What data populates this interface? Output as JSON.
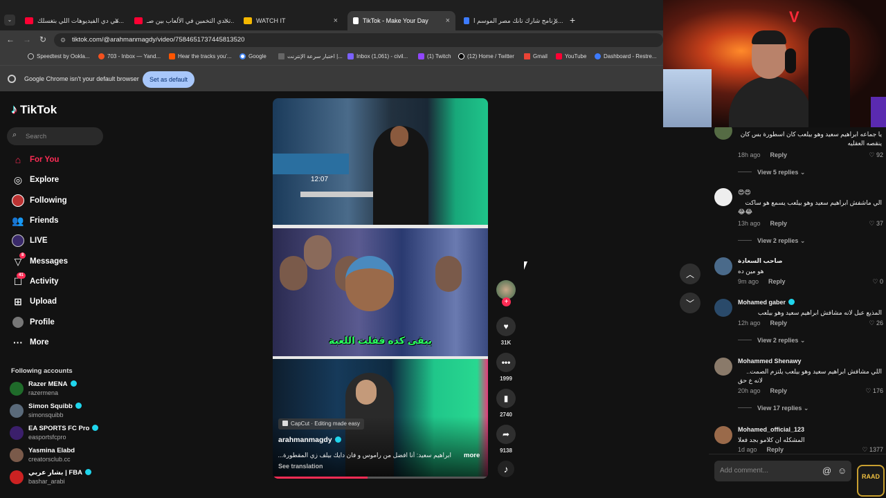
{
  "tabs": [
    {
      "title": "هي دي الفيديوهات اللي بتغسلك...",
      "icon_color": "#ff0033"
    },
    {
      "title": "تحدي التخمين في الألعاب بين صـ...",
      "icon_color": "#ff0033"
    },
    {
      "title": "WATCH IT",
      "icon_color": "#f5b800"
    },
    {
      "title": "TikTok - Make Your Day",
      "icon_color": "#ffffff"
    },
    {
      "title": "برنامج شارك تانك مصر الموسم ا...",
      "icon_color": "#3d7bff"
    }
  ],
  "address": {
    "url": "tiktok.com/@arahmanmagdy/video/7584651737445813520"
  },
  "bookmarks": [
    "Speedtest by Ookla...",
    "703 - Inbox — Yand...",
    "Hear the tracks you'...",
    "Google",
    "اختبار سرعة الإنترنت |...",
    "Inbox (1,061) - civil...",
    "(1) Twitch",
    "(12) Home / Twitter",
    "Gmail",
    "YouTube",
    "Dashboard - Restre..."
  ],
  "infobar": {
    "message": "Google Chrome isn't your default browser",
    "button": "Set as default"
  },
  "brand": {
    "logo_text": "TikTok"
  },
  "search": {
    "placeholder": "Search"
  },
  "nav": [
    {
      "label": "For You",
      "icon": "home-icon",
      "active": true
    },
    {
      "label": "Explore",
      "icon": "compass-icon"
    },
    {
      "label": "Following",
      "icon": "following-avatar-icon"
    },
    {
      "label": "Friends",
      "icon": "friends-icon"
    },
    {
      "label": "LIVE",
      "icon": "live-icon"
    },
    {
      "label": "Messages",
      "icon": "messages-icon",
      "badge": "8"
    },
    {
      "label": "Activity",
      "icon": "activity-icon",
      "badge": "41"
    },
    {
      "label": "Upload",
      "icon": "upload-icon"
    },
    {
      "label": "Profile",
      "icon": "profile-avatar-icon"
    },
    {
      "label": "More",
      "icon": "more-icon"
    }
  ],
  "following_section": {
    "title": "Following accounts"
  },
  "following_accounts": [
    {
      "name": "Razer MENA",
      "handle": "razermena",
      "verified": true,
      "color": "#1f6b2a"
    },
    {
      "name": "Simon Squibb",
      "handle": "simonsquibb",
      "verified": true,
      "color": "#5a6a7a"
    },
    {
      "name": "EA SPORTS FC Pro",
      "handle": "easportsfcpro",
      "verified": true,
      "color": "#3b1f6b"
    },
    {
      "name": "Yasmina Elabd",
      "handle": "creatorsclub.cc",
      "verified": false,
      "color": "#7a5a4a"
    },
    {
      "name": "بشار عربي | FBA",
      "handle": "bashar_arabi",
      "verified": true,
      "color": "#c22"
    }
  ],
  "video": {
    "subtitle": "يبقى كده قفلت اللعبة",
    "capcut_label": "CapCut · Editing made easy",
    "author": "arahmanmagdy",
    "caption": "ابراهيم سعيد: أنا افضل من راموس و فان دايك بيلف زي المقطورة...",
    "more": "more",
    "translate": "See translation",
    "scoreboard": "12:07"
  },
  "actions": {
    "likes": "31K",
    "comments": "1999",
    "saves": "2740",
    "shares": "9138"
  },
  "comments": [
    {
      "user": "",
      "text": "يا جماعه ابراهيم سعيد وهو بيلعب كان اسطورة بس كان ينقصه العقليه",
      "time": "18h ago",
      "reply": "Reply",
      "likes": "92",
      "views": "View 5 replies",
      "color": "#556b44"
    },
    {
      "user": "",
      "emoji_line": "😍😍",
      "text": "الي ماشفش ابراهيم سعيد وهو بيلعب يسمع هو ساكت",
      "text2": "😂😂",
      "time": "13h ago",
      "reply": "Reply",
      "likes": "37",
      "views": "View 2 replies",
      "color": "#ddd"
    },
    {
      "user": "صاحب السعادة",
      "text": "هو مين ده",
      "time": "9m ago",
      "reply": "Reply",
      "likes": "0",
      "views": "",
      "color": "#4a6a8a"
    },
    {
      "user": "Mohamed gaber",
      "verified": true,
      "text": "المذيع عبل لانه مشافش ابراهيم سعيد وهو بيلعب",
      "time": "12h ago",
      "reply": "Reply",
      "likes": "26",
      "views": "View 2 replies",
      "color": "#2a4a6a"
    },
    {
      "user": "Mohammed Shenawy",
      "text": "اللي مشافش ابراهيم سعيد وهو بيلعب يلتزم الصمت..",
      "text2": "لانه ع حق",
      "time": "20h ago",
      "reply": "Reply",
      "likes": "176",
      "views": "View 17 replies",
      "color": "#8a7a6a"
    },
    {
      "user": "Mohamed_official_123",
      "text": "المشكله ان كلامو بجد فعلا",
      "time": "1d ago",
      "reply": "Reply",
      "likes": "1377",
      "views": "",
      "color": "#9a6a4a"
    }
  ],
  "comment_input": {
    "placeholder": "Add comment..."
  },
  "webcam": {
    "logo": "RAAD"
  }
}
